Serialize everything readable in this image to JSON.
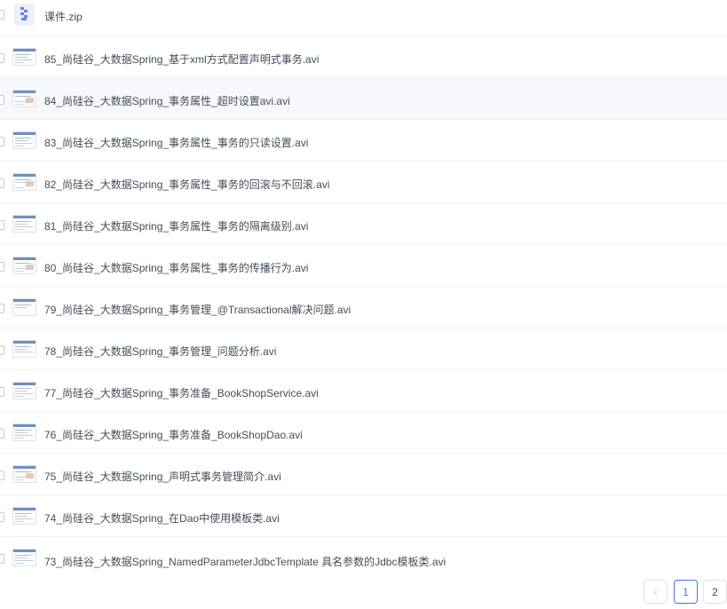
{
  "files": [
    {
      "name": "课件.zip",
      "type": "zip"
    },
    {
      "name": "85_尚硅谷_大数据Spring_基于xml方式配置声明式事务.avi",
      "type": "video"
    },
    {
      "name": "84_尚硅谷_大数据Spring_事务属性_超时设置avi.avi",
      "type": "video"
    },
    {
      "name": "83_尚硅谷_大数据Spring_事务属性_事务的只读设置.avi",
      "type": "video"
    },
    {
      "name": "82_尚硅谷_大数据Spring_事务属性_事务的回滚与不回滚.avi",
      "type": "video"
    },
    {
      "name": "81_尚硅谷_大数据Spring_事务属性_事务的隔离级别.avi",
      "type": "video"
    },
    {
      "name": "80_尚硅谷_大数据Spring_事务属性_事务的传播行为.avi",
      "type": "video"
    },
    {
      "name": "79_尚硅谷_大数据Spring_事务管理_@Transactional解决问题.avi",
      "type": "video"
    },
    {
      "name": "78_尚硅谷_大数据Spring_事务管理_问题分析.avi",
      "type": "video"
    },
    {
      "name": "77_尚硅谷_大数据Spring_事务准备_BookShopService.avi",
      "type": "video"
    },
    {
      "name": "76_尚硅谷_大数据Spring_事务准备_BookShopDao.avi",
      "type": "video"
    },
    {
      "name": "75_尚硅谷_大数据Spring_声明式事务管理简介.avi",
      "type": "video"
    },
    {
      "name": "74_尚硅谷_大数据Spring_在Dao中使用模板类.avi",
      "type": "video"
    },
    {
      "name": "73_尚硅谷_大数据Spring_NamedParameterJdbcTemplate 具名参数的Jdbc模板类.avi",
      "type": "video"
    }
  ],
  "pagination": {
    "prev_label": "‹",
    "pages": [
      "1",
      "2"
    ],
    "current": "1"
  },
  "colors": {
    "accent": "#4a6ef5",
    "text": "#454d5a",
    "hover_row": "#f7f8fc",
    "zip_icon": "#6a7cf0"
  }
}
